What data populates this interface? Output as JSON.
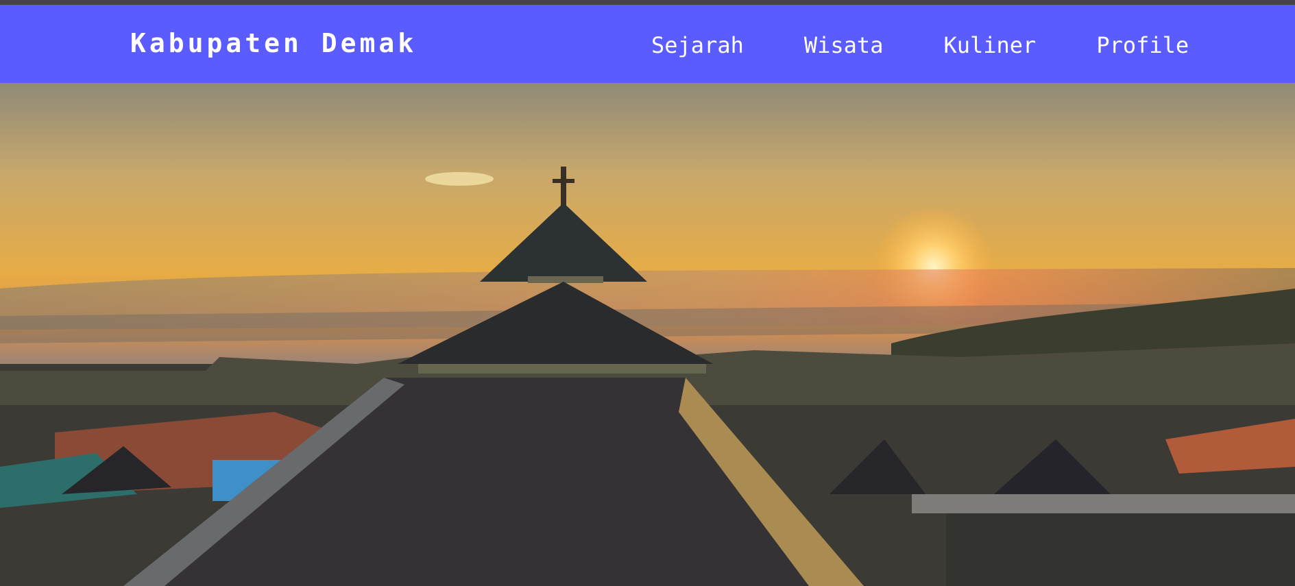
{
  "header": {
    "brand": "Kabupaten Demak",
    "nav": [
      {
        "label": "Sejarah"
      },
      {
        "label": "Wisata"
      },
      {
        "label": "Kuliner"
      },
      {
        "label": "Profile"
      }
    ]
  },
  "colors": {
    "navbar": "#5a5cff",
    "text": "#ffffff",
    "top_strip": "#444444"
  },
  "hero": {
    "image": "sunset-mosque-photo"
  }
}
